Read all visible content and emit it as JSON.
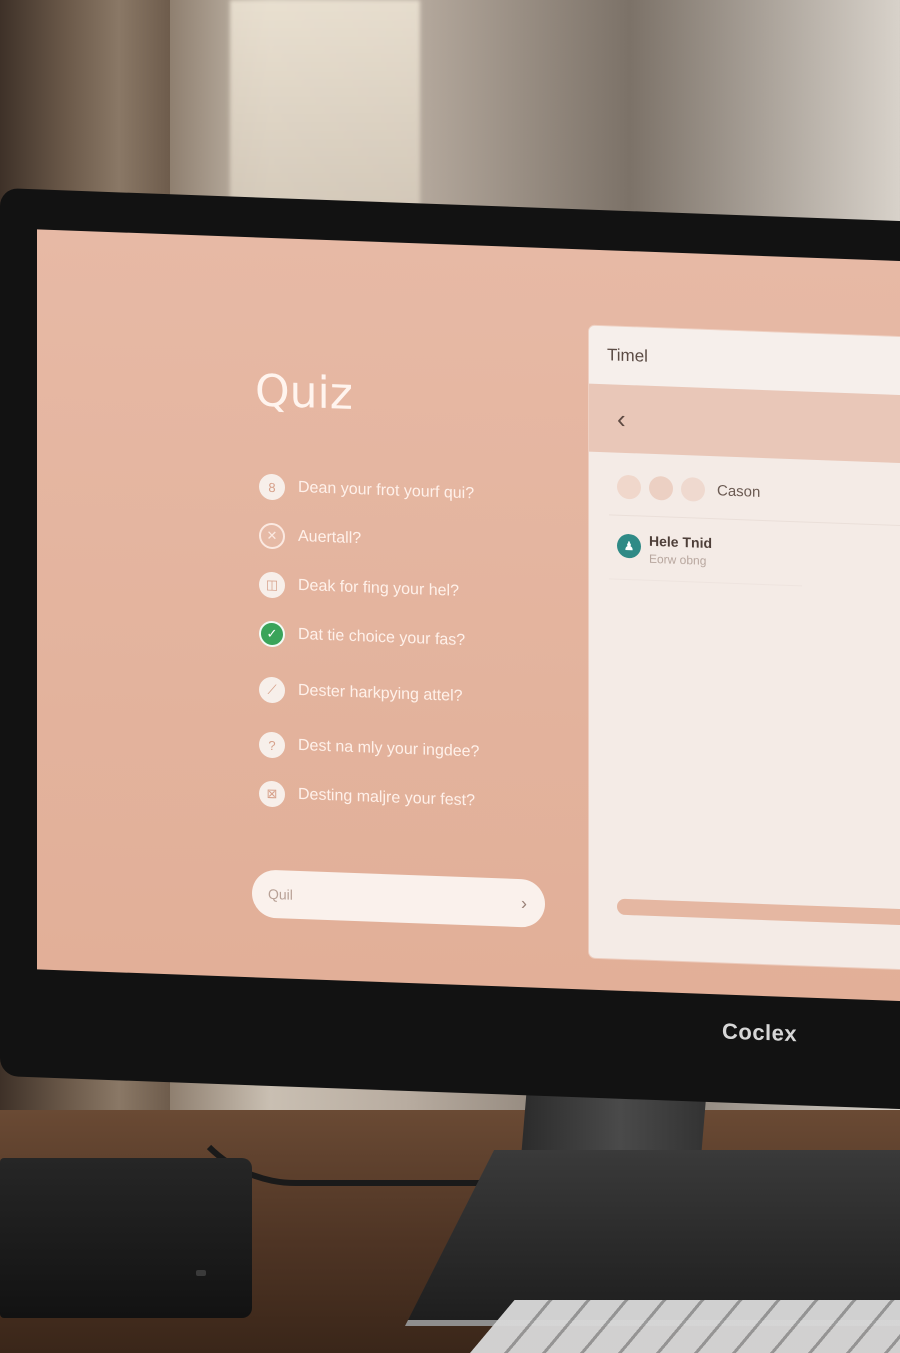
{
  "quiz": {
    "title": "Quiz",
    "items": [
      {
        "label": "Dean your frot yourf qui?",
        "icon": "info-circle-icon",
        "glyph": "8"
      },
      {
        "label": "Auertall?",
        "icon": "close-circle-icon",
        "glyph": "✕"
      },
      {
        "label": "Deak for fing your hel?",
        "icon": "image-circle-icon",
        "glyph": "◫"
      },
      {
        "label": "Dat tie choice your fas?",
        "icon": "check-circle-icon",
        "glyph": "✓"
      },
      {
        "label": "Dester harkpying attel?",
        "icon": "pencil-circle-icon",
        "glyph": "⟋"
      },
      {
        "label": "Dest na mly your ingdee?",
        "icon": "question-circle-icon",
        "glyph": "?"
      },
      {
        "label": "Desting maljre your fest?",
        "icon": "grid-circle-icon",
        "glyph": "⊠"
      }
    ],
    "search_placeholder": "Quil",
    "search_icon": "chevron-right-icon"
  },
  "window": {
    "title": "Timel",
    "back_icon": "chevron-left-icon",
    "chips_label": "Cason",
    "contact": {
      "name": "Hele Tnid",
      "subtitle": "Eorw obng",
      "avatar_icon": "person-icon",
      "avatar_color": "#2f8a86"
    },
    "progress": 1.0
  },
  "monitor": {
    "brand": "Coclex"
  },
  "colors": {
    "screen_bg": "#e3b39d",
    "accent": "#e5b7a2",
    "check_green": "#3aa45a"
  }
}
